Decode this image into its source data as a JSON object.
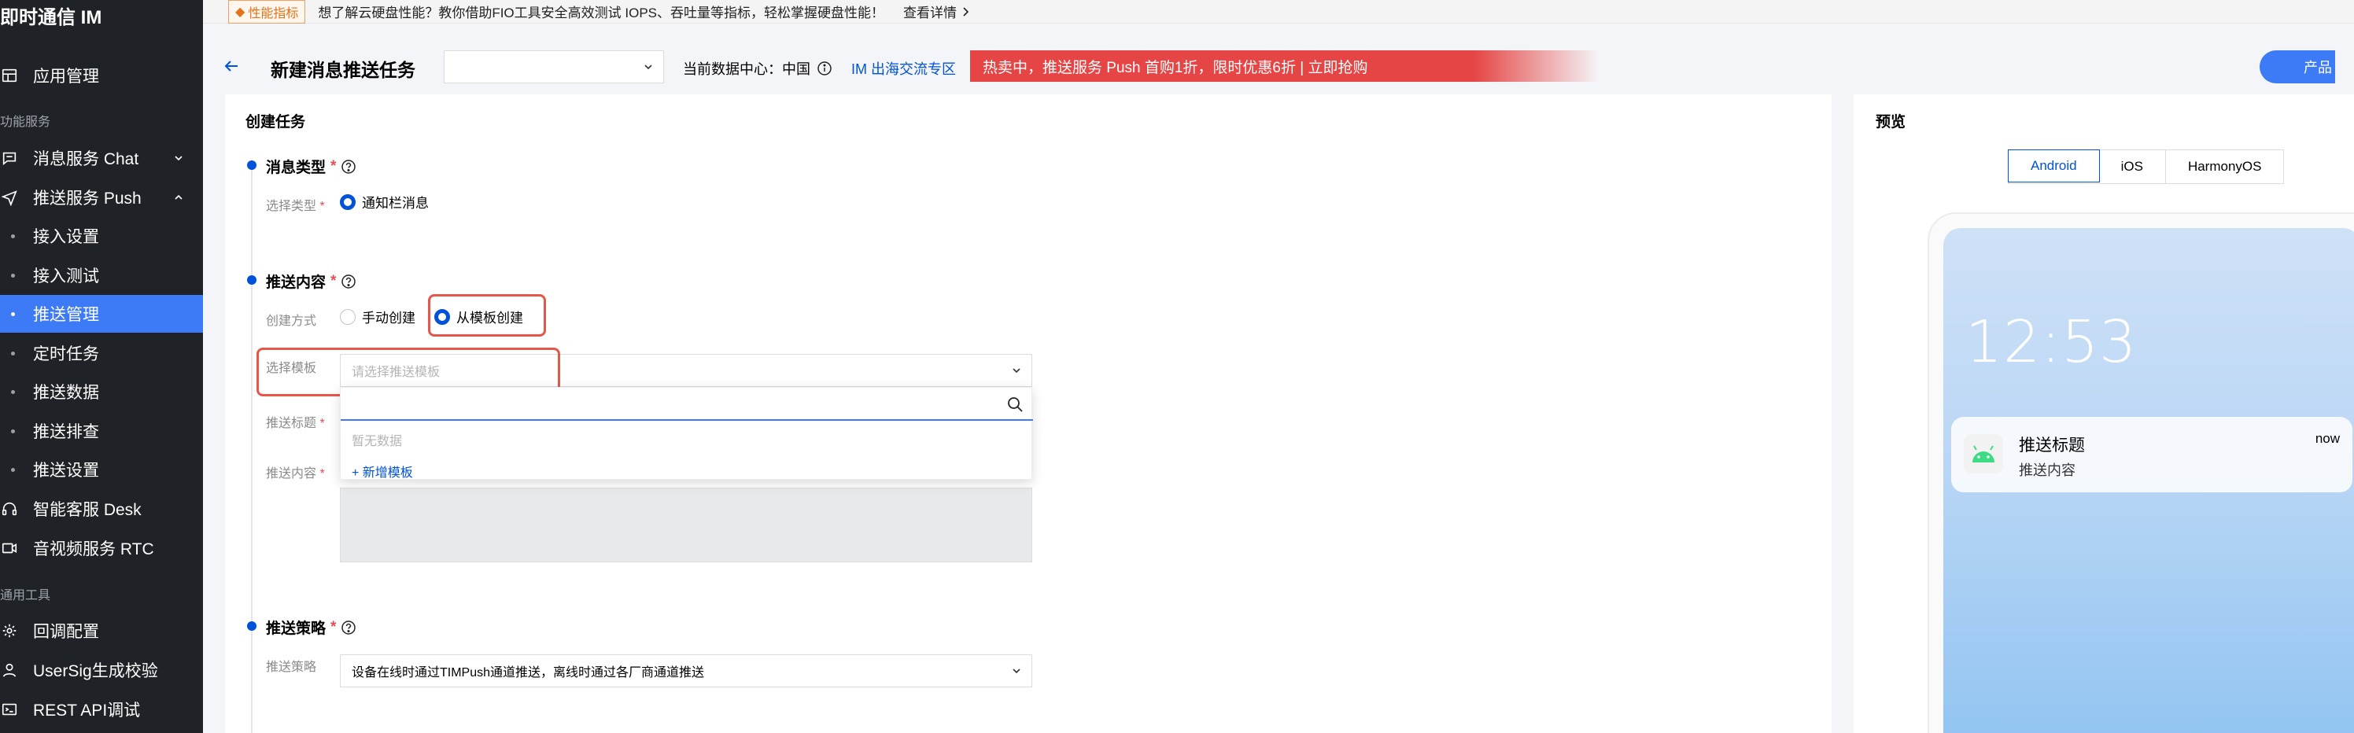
{
  "sidebar": {
    "title": "即时通信 IM",
    "app_mgmt": "应用管理",
    "group_services": "功能服务",
    "chat": "消息服务 Chat",
    "push": "推送服务 Push",
    "push_items": [
      "接入设置",
      "接入测试",
      "推送管理",
      "定时任务",
      "推送数据",
      "推送排查",
      "推送设置"
    ],
    "push_active_index": 2,
    "desk": "智能客服 Desk",
    "rtc": "音视频服务 RTC",
    "group_tools": "通用工具",
    "callback": "回调配置",
    "usersig": "UserSig生成校验",
    "restapi": "REST API调试"
  },
  "banner": {
    "badge": "性能指标",
    "text": "想了解云硬盘性能？教你借助FIO工具安全高效测试 IOPS、吞吐量等指标，轻松掌握硬盘性能！",
    "link": "查看详情"
  },
  "header": {
    "title": "新建消息推送任务",
    "datacenter": "当前数据中心：中国",
    "im_zone": "IM 出海交流专区",
    "promo": "热卖中，推送服务 Push 首购1折，限时优惠6折 | 立即抢购",
    "product_btn": "产品"
  },
  "form": {
    "section_title": "创建任务",
    "msg_type_title": "消息类型",
    "msg_type_label": "选择类型",
    "msg_type_option": "通知栏消息",
    "content_title": "推送内容",
    "create_mode_label": "创建方式",
    "mode_manual": "手动创建",
    "mode_template": "从模板创建",
    "template_label": "选择模板",
    "template_placeholder": "请选择推送模板",
    "dropdown_empty": "暂无数据",
    "dropdown_add": "+ 新增模板",
    "push_title_label": "推送标题",
    "push_content_label": "推送内容",
    "strategy_title": "推送策略",
    "strategy_label": "推送策略",
    "strategy_value": "设备在线时通过TIMPush通道推送，离线时通过各厂商通道推送",
    "required_mark": "*"
  },
  "preview": {
    "title": "预览",
    "tabs": [
      "Android",
      "iOS",
      "HarmonyOS"
    ],
    "active_tab": 0,
    "clock": "12:53",
    "notif_title": "推送标题",
    "notif_body": "推送内容",
    "notif_time": "now"
  },
  "colors": {
    "accent": "#0052d9",
    "sidebar_bg": "#1f2227",
    "active_item": "#3d7af5",
    "highlight": "#e5574a",
    "promo": "#e54545"
  }
}
